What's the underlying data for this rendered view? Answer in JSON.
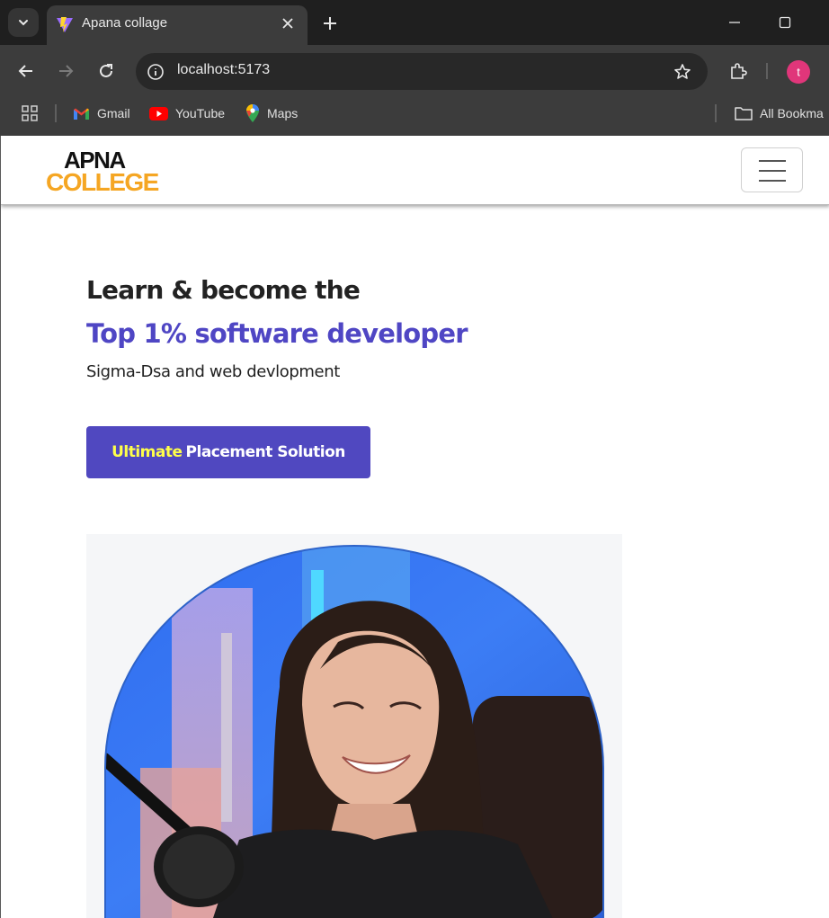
{
  "browser": {
    "tab_title": "Apana collage",
    "url": "localhost:5173",
    "profile_initial": "t",
    "bookmarks": [
      {
        "label": "Gmail",
        "icon": "gmail-icon"
      },
      {
        "label": "YouTube",
        "icon": "youtube-icon"
      },
      {
        "label": "Maps",
        "icon": "maps-icon"
      }
    ],
    "all_bookmarks_label": "All Bookma"
  },
  "site": {
    "logo_top": "APNA",
    "logo_bottom": "COLLEGE",
    "heading": "Learn & become the",
    "highlight": "Top 1% software developer",
    "subheading": "Sigma-Dsa and web devlopment",
    "cta_accent": "Ultimate",
    "cta_label": "Placement Solution"
  },
  "colors": {
    "brand_primary": "#5048c0",
    "highlight_text": "#4f46c4",
    "cta_accent": "#ffff4a",
    "logo_orange": "#f5a623"
  }
}
